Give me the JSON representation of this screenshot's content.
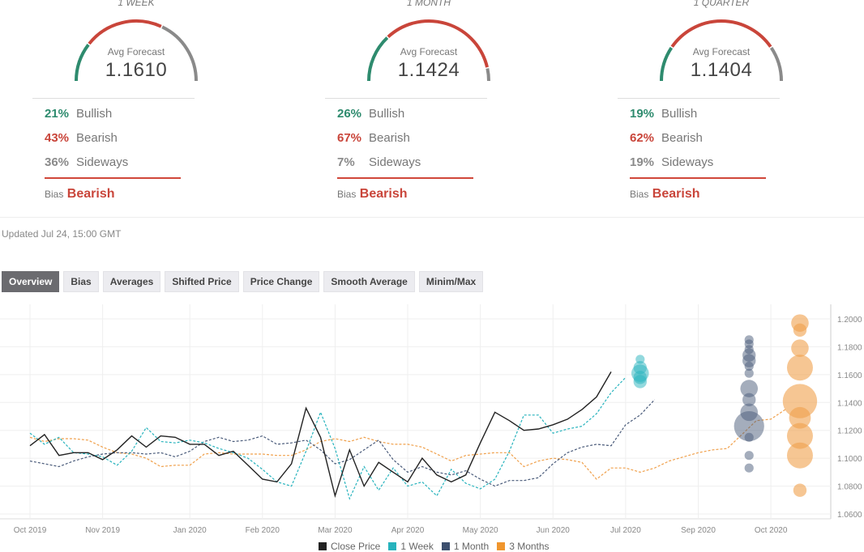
{
  "colors": {
    "bullish": "#2e8b6e",
    "bearish": "#c9453a",
    "sideways": "#8a8a8a",
    "close": "#222222",
    "week": "#27b3bd",
    "month": "#4a5b7a",
    "quarter": "#f0a04b"
  },
  "gauges": [
    {
      "title": "1 WEEK",
      "avg_label": "Avg Forecast",
      "avg_value": "1.1610",
      "bullish_pct": "21%",
      "bullish_label": "Bullish",
      "bullish": 21,
      "bearish_pct": "43%",
      "bearish_label": "Bearish",
      "bearish": 43,
      "sideways_pct": "36%",
      "sideways_label": "Sideways",
      "sideways": 36,
      "bias_label": "Bias",
      "bias_value": "Bearish"
    },
    {
      "title": "1 MONTH",
      "avg_label": "Avg Forecast",
      "avg_value": "1.1424",
      "bullish_pct": "26%",
      "bullish_label": "Bullish",
      "bullish": 26,
      "bearish_pct": "67%",
      "bearish_label": "Bearish",
      "bearish": 67,
      "sideways_pct": "7%",
      "sideways_label": "Sideways",
      "sideways": 7,
      "bias_label": "Bias",
      "bias_value": "Bearish"
    },
    {
      "title": "1 QUARTER",
      "avg_label": "Avg Forecast",
      "avg_value": "1.1404",
      "bullish_pct": "19%",
      "bullish_label": "Bullish",
      "bullish": 19,
      "bearish_pct": "62%",
      "bearish_label": "Bearish",
      "bearish": 62,
      "sideways_pct": "19%",
      "sideways_label": "Sideways",
      "sideways": 19,
      "bias_label": "Bias",
      "bias_value": "Bearish"
    }
  ],
  "updated": "Updated Jul 24, 15:00 GMT",
  "tabs": [
    {
      "label": "Overview",
      "active": true
    },
    {
      "label": "Bias"
    },
    {
      "label": "Averages"
    },
    {
      "label": "Shifted Price"
    },
    {
      "label": "Price Change"
    },
    {
      "label": "Smooth Average"
    },
    {
      "label": "Minim/Max"
    }
  ],
  "chart_data": {
    "type": "line",
    "ylim": [
      1.06,
      1.2
    ],
    "yticks": [
      "1.2000",
      "1.1800",
      "1.1600",
      "1.1400",
      "1.1200",
      "1.1000",
      "1.0800",
      "1.0600"
    ],
    "ytick_values": [
      1.2,
      1.18,
      1.16,
      1.14,
      1.12,
      1.1,
      1.08,
      1.06
    ],
    "xticks": [
      "Oct 2019",
      "Nov 2019",
      "Jan 2020",
      "Feb 2020",
      "Mar 2020",
      "Apr 2020",
      "May 2020",
      "Jun 2020",
      "Jul 2020",
      "Sep 2020",
      "Oct 2020"
    ],
    "x_range_weeks": [
      0,
      54
    ],
    "xtick_weeks": [
      0,
      5,
      11,
      16,
      21,
      26,
      31,
      36,
      41,
      46,
      51
    ],
    "legend": [
      "Close Price",
      "1 Week",
      "1 Month",
      "3 Months"
    ],
    "legend_position": "bottom",
    "series": [
      {
        "name": "Close Price",
        "style": "solid",
        "x": [
          0,
          1,
          2,
          3,
          4,
          5,
          6,
          7,
          8,
          9,
          10,
          11,
          12,
          13,
          14,
          15,
          16,
          17,
          18,
          19,
          20,
          21,
          22,
          23,
          24,
          25,
          26,
          27,
          28,
          29,
          30,
          31,
          32,
          33,
          34,
          35,
          36,
          37,
          38,
          39,
          40
        ],
        "values": [
          1.109,
          1.117,
          1.102,
          1.104,
          1.104,
          1.099,
          1.106,
          1.116,
          1.108,
          1.116,
          1.115,
          1.11,
          1.11,
          1.102,
          1.105,
          1.095,
          1.085,
          1.083,
          1.096,
          1.136,
          1.115,
          1.073,
          1.106,
          1.08,
          1.097,
          1.09,
          1.083,
          1.1,
          1.088,
          1.083,
          1.088,
          1.111,
          1.133,
          1.127,
          1.12,
          1.121,
          1.124,
          1.128,
          1.135,
          1.144,
          1.162
        ]
      },
      {
        "name": "1 Week",
        "style": "dashed",
        "x": [
          0,
          1,
          2,
          3,
          4,
          5,
          6,
          7,
          8,
          9,
          10,
          11,
          12,
          13,
          14,
          15,
          16,
          17,
          18,
          19,
          20,
          21,
          22,
          23,
          24,
          25,
          26,
          27,
          28,
          29,
          30,
          31,
          32,
          33,
          34,
          35,
          36,
          37,
          38,
          39,
          40,
          41
        ],
        "values": [
          1.118,
          1.11,
          1.115,
          1.104,
          1.103,
          1.101,
          1.095,
          1.105,
          1.122,
          1.112,
          1.111,
          1.113,
          1.111,
          1.107,
          1.104,
          1.1,
          1.092,
          1.083,
          1.08,
          1.105,
          1.133,
          1.107,
          1.071,
          1.094,
          1.077,
          1.093,
          1.08,
          1.083,
          1.073,
          1.092,
          1.082,
          1.078,
          1.085,
          1.105,
          1.131,
          1.131,
          1.118,
          1.121,
          1.123,
          1.132,
          1.147,
          1.158
        ]
      },
      {
        "name": "1 Month",
        "style": "dashed",
        "x": [
          0,
          1,
          2,
          3,
          4,
          5,
          6,
          7,
          8,
          9,
          10,
          11,
          12,
          13,
          14,
          15,
          16,
          17,
          18,
          19,
          20,
          21,
          22,
          23,
          24,
          25,
          26,
          27,
          28,
          29,
          30,
          31,
          32,
          33,
          34,
          35,
          36,
          37,
          38,
          39,
          40,
          41,
          42,
          43
        ],
        "values": [
          1.098,
          1.096,
          1.094,
          1.098,
          1.101,
          1.103,
          1.104,
          1.104,
          1.103,
          1.104,
          1.101,
          1.105,
          1.112,
          1.115,
          1.112,
          1.113,
          1.116,
          1.11,
          1.111,
          1.113,
          1.106,
          1.096,
          1.099,
          1.106,
          1.113,
          1.099,
          1.09,
          1.094,
          1.09,
          1.088,
          1.091,
          1.085,
          1.08,
          1.084,
          1.084,
          1.086,
          1.096,
          1.104,
          1.108,
          1.11,
          1.109,
          1.124,
          1.131,
          1.142
        ]
      },
      {
        "name": "3 Months",
        "style": "dashed",
        "x": [
          0,
          1,
          2,
          3,
          4,
          5,
          6,
          7,
          8,
          9,
          10,
          11,
          12,
          13,
          14,
          15,
          16,
          17,
          18,
          19,
          20,
          21,
          22,
          23,
          24,
          25,
          26,
          27,
          28,
          29,
          30,
          31,
          32,
          33,
          34,
          35,
          36,
          37,
          38,
          39,
          40,
          41,
          42,
          43,
          44,
          45,
          46,
          47,
          48,
          49,
          50,
          51,
          52
        ],
        "values": [
          1.115,
          1.112,
          1.114,
          1.114,
          1.113,
          1.108,
          1.104,
          1.103,
          1.1,
          1.094,
          1.095,
          1.095,
          1.103,
          1.104,
          1.103,
          1.103,
          1.103,
          1.102,
          1.102,
          1.106,
          1.112,
          1.114,
          1.112,
          1.115,
          1.112,
          1.11,
          1.11,
          1.108,
          1.103,
          1.098,
          1.102,
          1.103,
          1.104,
          1.104,
          1.094,
          1.098,
          1.1,
          1.099,
          1.097,
          1.085,
          1.093,
          1.093,
          1.09,
          1.093,
          1.098,
          1.101,
          1.104,
          1.106,
          1.107,
          1.117,
          1.127,
          1.128,
          1.135
        ]
      }
    ],
    "bubbles": [
      {
        "name": "1 Week",
        "x": 42,
        "points": [
          {
            "y": 1.171,
            "size": 1
          },
          {
            "y": 1.165,
            "size": 2
          },
          {
            "y": 1.161,
            "size": 3
          },
          {
            "y": 1.158,
            "size": 2
          },
          {
            "y": 1.155,
            "size": 2
          }
        ]
      },
      {
        "name": "1 Month",
        "x": 49.5,
        "points": [
          {
            "y": 1.185,
            "size": 1
          },
          {
            "y": 1.182,
            "size": 1
          },
          {
            "y": 1.178,
            "size": 1
          },
          {
            "y": 1.174,
            "size": 2
          },
          {
            "y": 1.17,
            "size": 2
          },
          {
            "y": 1.166,
            "size": 1
          },
          {
            "y": 1.161,
            "size": 1
          },
          {
            "y": 1.15,
            "size": 3
          },
          {
            "y": 1.142,
            "size": 2
          },
          {
            "y": 1.133,
            "size": 3
          },
          {
            "y": 1.123,
            "size": 6
          },
          {
            "y": 1.115,
            "size": 1
          },
          {
            "y": 1.102,
            "size": 1
          },
          {
            "y": 1.093,
            "size": 1
          }
        ]
      },
      {
        "name": "3 Months",
        "x": 53,
        "points": [
          {
            "y": 1.197,
            "size": 3
          },
          {
            "y": 1.192,
            "size": 2
          },
          {
            "y": 1.179,
            "size": 3
          },
          {
            "y": 1.165,
            "size": 5
          },
          {
            "y": 1.141,
            "size": 7
          },
          {
            "y": 1.129,
            "size": 4
          },
          {
            "y": 1.116,
            "size": 5
          },
          {
            "y": 1.102,
            "size": 5
          },
          {
            "y": 1.077,
            "size": 2
          }
        ]
      }
    ]
  }
}
